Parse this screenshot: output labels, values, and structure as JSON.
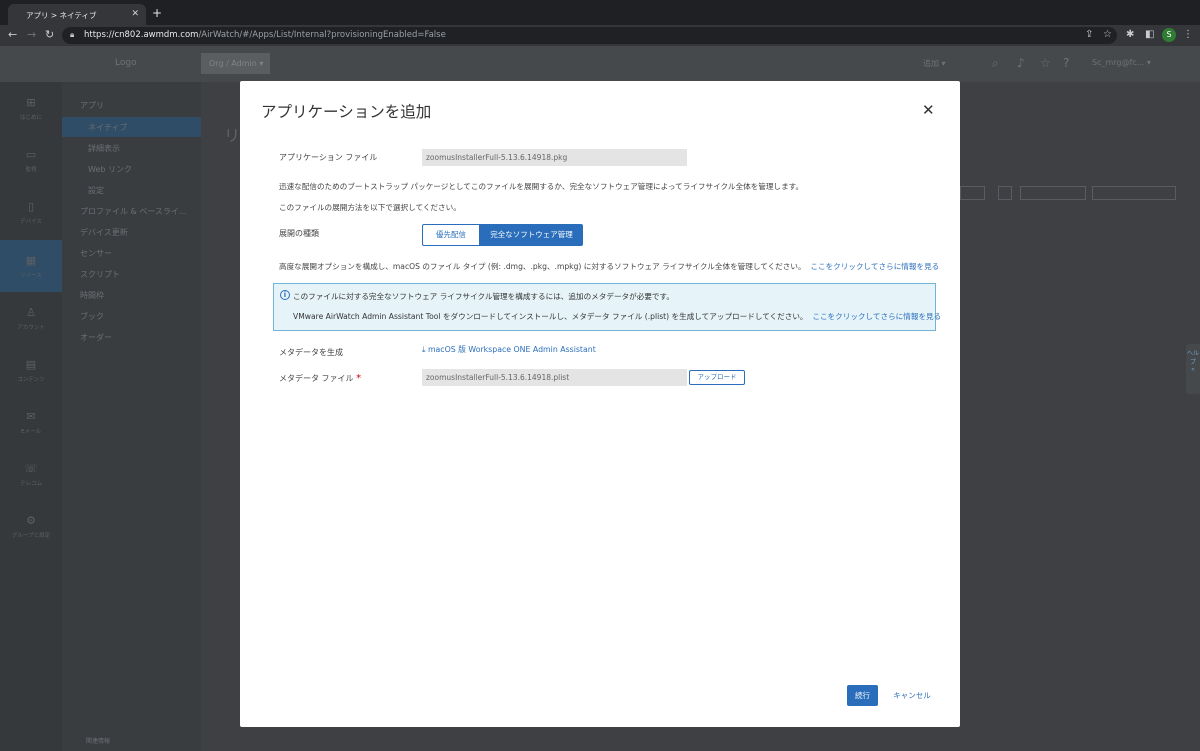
{
  "browser": {
    "tab_title": "アプリ > ネイティブ",
    "tab_close": "✕",
    "new_tab": "+",
    "url_host": "https://cn802.awmdm.com",
    "url_path": "/AirWatch/#/Apps/List/Internal?provisioningEnabled=False",
    "avatar_letter": "S"
  },
  "background_app": {
    "logo": "Logo",
    "org_button": "Org / Admin ▾",
    "add_label": "追加 ▾",
    "user_label": "Sc_mrg@fc... ▾",
    "rail": [
      {
        "label": "はじめに",
        "icon": "⊞"
      },
      {
        "label": "監視",
        "icon": "▭"
      },
      {
        "label": "デバイス",
        "icon": "▯"
      },
      {
        "label": "リソース",
        "icon": "▦"
      },
      {
        "label": "アカウント",
        "icon": "♙"
      },
      {
        "label": "コンテンツ",
        "icon": "▤"
      },
      {
        "label": "Eメール",
        "icon": "✉"
      },
      {
        "label": "テレコム",
        "icon": "☏"
      },
      {
        "label": "グループと設定",
        "icon": "⚙"
      }
    ],
    "subnav": {
      "section": "アプリ",
      "items": [
        "ネイティブ",
        "詳細表示",
        "Web リンク",
        "設定",
        "プロファイル & ベースライ...",
        "デバイス更新",
        "センサー",
        "スクリプト",
        "時間枠",
        "ブック",
        "オーダー"
      ],
      "footer": "関連情報"
    },
    "page_title": "リ"
  },
  "modal": {
    "title": "アプリケーションを追加",
    "close_icon": "✕",
    "app_file_label": "アプリケーション ファイル",
    "app_file_value": "zoomusInstallerFull-5.13.6.14918.pkg",
    "description": "迅速な配信のためのブートストラップ パッケージとしてこのファイルを展開するか、完全なソフトウェア管理によってライフサイクル全体を管理します。",
    "deploy_instruction": "このファイルの展開方法を以下で選択してください。",
    "deploy_type_label": "展開の種類",
    "deploy_options": [
      "優先配信",
      "完全なソフトウェア管理"
    ],
    "selected_option": "完全なソフトウェア管理",
    "advanced_text": "高度な展開オプションを構成し、macOS のファイル タイプ (例: .dmg、.pkg、.mpkg) に対するソフトウェア ライフサイクル全体を管理してください。",
    "advanced_link": "ここをクリックしてさらに情報を見る",
    "info": {
      "icon": "info-icon",
      "line1": "このファイルに対する完全なソフトウェア ライフサイクル管理を構成するには、追加のメタデータが必要です。",
      "line2": "VMware AirWatch Admin Assistant Tool をダウンロードしてインストールし、メタデータ ファイル (.plist) を生成してアップロードしてください。",
      "link": "ここをクリックしてさらに情報を見る"
    },
    "generate_label": "メタデータを生成",
    "download_link": "macOS 版 Workspace ONE Admin Assistant",
    "metadata_file_label": "メタデータ ファイル",
    "required_mark": "*",
    "metadata_file_value": "zoomusInstallerFull-5.13.6.14918.plist",
    "upload_button": "アップロード",
    "continue_button": "続行",
    "cancel_button": "キャンセル"
  },
  "side_tab": "ヘルプ"
}
